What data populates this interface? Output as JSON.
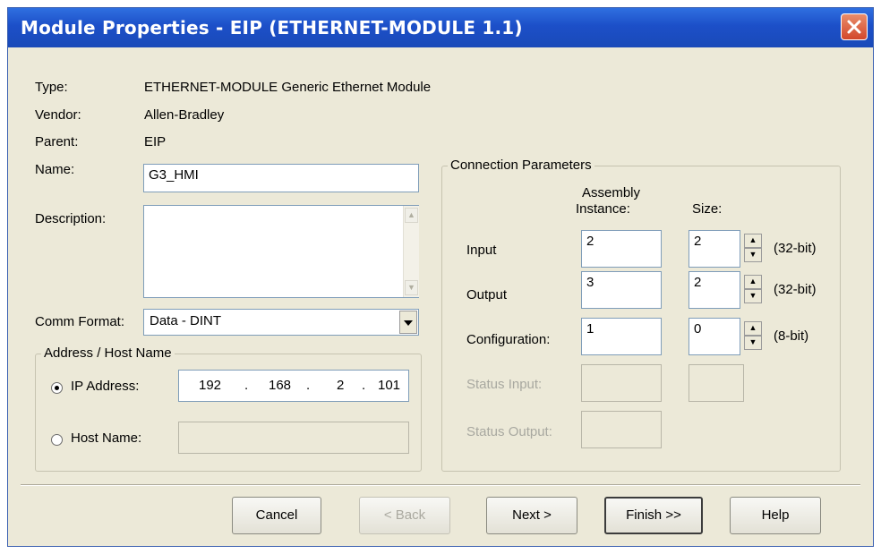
{
  "window": {
    "title": "Module Properties - EIP (ETHERNET-MODULE 1.1)"
  },
  "info": {
    "type_label": "Type:",
    "type_value": "ETHERNET-MODULE Generic Ethernet Module",
    "vendor_label": "Vendor:",
    "vendor_value": "Allen-Bradley",
    "parent_label": "Parent:",
    "parent_value": "EIP",
    "name_label": "Name:",
    "name_value": "G3_HMI",
    "description_label": "Description:",
    "description_value": "",
    "comm_format_label": "Comm Format:",
    "comm_format_value": "Data - DINT"
  },
  "address": {
    "group_label": "Address / Host Name",
    "ip_label": "IP Address:",
    "ip_octets": [
      "192",
      "168",
      "2",
      "101"
    ],
    "ip_dot": ".",
    "host_label": "Host Name:",
    "host_value": "",
    "selected": "ip"
  },
  "connection": {
    "group_label": "Connection Parameters",
    "col_instance": "Assembly Instance:",
    "col_instance_line1": "Assembly",
    "col_instance_line2": "Instance:",
    "col_size": "Size:",
    "rows": [
      {
        "label": "Input",
        "instance": "2",
        "size": "2",
        "unit": "(32-bit)",
        "enabled": true
      },
      {
        "label": "Output",
        "instance": "3",
        "size": "2",
        "unit": "(32-bit)",
        "enabled": true
      },
      {
        "label": "Configuration:",
        "instance": "1",
        "size": "0",
        "unit": "(8-bit)",
        "enabled": true
      },
      {
        "label": "Status Input:",
        "instance": "",
        "size": "",
        "unit": "",
        "enabled": false
      },
      {
        "label": "Status Output:",
        "instance": "",
        "size": "",
        "unit": "",
        "enabled": false
      }
    ]
  },
  "buttons": {
    "cancel": "Cancel",
    "back": "< Back",
    "next": "Next >",
    "finish": "Finish >>",
    "help": "Help"
  },
  "icons": {
    "close": "close-icon",
    "spin_up": "spin-up-icon",
    "spin_down": "spin-down-icon",
    "dropdown": "chevron-down-icon"
  },
  "colors": {
    "title_bar": "#1c4fc8",
    "close_button": "#d2472b",
    "dialog_bg": "#ece9d8"
  }
}
